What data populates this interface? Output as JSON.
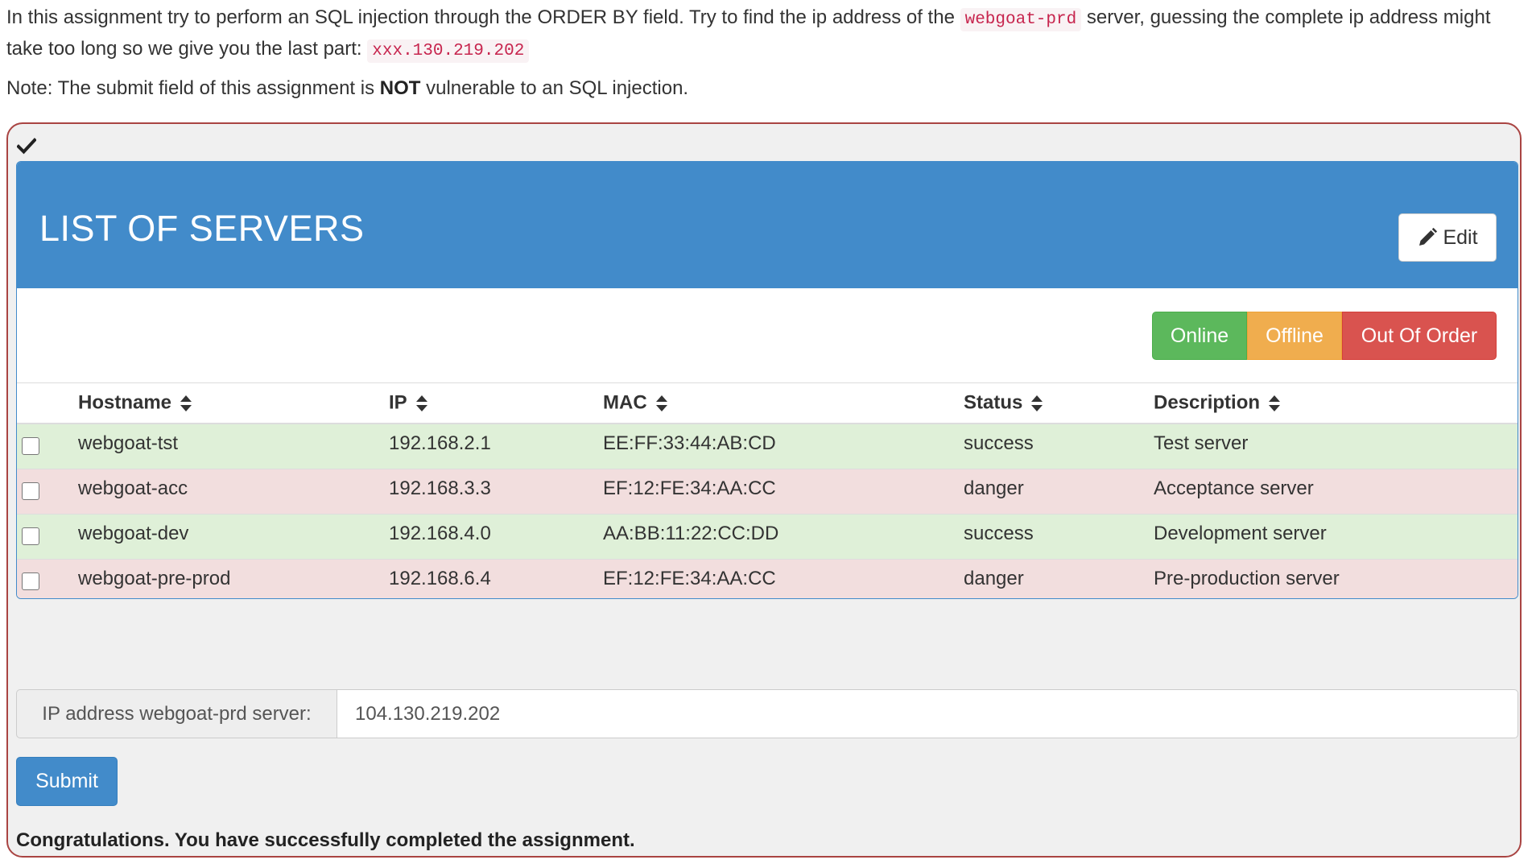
{
  "intro": {
    "text_1": "In this assignment try to perform an SQL injection through the ORDER BY field. Try to find the ip address of the ",
    "code_1": "webgoat-prd",
    "text_2": " server, guessing the complete ip address might take too long so we give you the last part: ",
    "code_2": "xxx.130.219.202"
  },
  "note": {
    "prefix": "Note: The submit field of this assignment is ",
    "emphasis": "NOT",
    "suffix": " vulnerable to an SQL injection."
  },
  "panel": {
    "title": "LIST OF SERVERS",
    "edit_label": "Edit",
    "status_buttons": {
      "online": "Online",
      "offline": "Offline",
      "out_of_order": "Out Of Order"
    }
  },
  "table": {
    "columns": [
      "Hostname",
      "IP",
      "MAC",
      "Status",
      "Description"
    ],
    "rows": [
      {
        "hostname": "webgoat-tst",
        "ip": "192.168.2.1",
        "mac": "EE:FF:33:44:AB:CD",
        "status": "success",
        "description": "Test server"
      },
      {
        "hostname": "webgoat-acc",
        "ip": "192.168.3.3",
        "mac": "EF:12:FE:34:AA:CC",
        "status": "danger",
        "description": "Acceptance server"
      },
      {
        "hostname": "webgoat-dev",
        "ip": "192.168.4.0",
        "mac": "AA:BB:11:22:CC:DD",
        "status": "success",
        "description": "Development server"
      },
      {
        "hostname": "webgoat-pre-prod",
        "ip": "192.168.6.4",
        "mac": "EF:12:FE:34:AA:CC",
        "status": "danger",
        "description": "Pre-production server"
      }
    ]
  },
  "form": {
    "addon_label": "IP address webgoat-prd server:",
    "ip_value": "104.130.219.202",
    "submit_label": "Submit"
  },
  "feedback": "Congratulations. You have successfully completed the assignment.",
  "icons": {
    "assignment_status": "checkmark-icon",
    "edit": "pencil-icon",
    "sort": "sort-icon"
  },
  "colors": {
    "panel_primary": "#428bca",
    "success_row": "#dff0d8",
    "danger_row": "#f2dede",
    "online": "#5cb85c",
    "offline": "#f0ad4e",
    "out_of_order": "#d9534f",
    "container_border": "#a94442"
  }
}
